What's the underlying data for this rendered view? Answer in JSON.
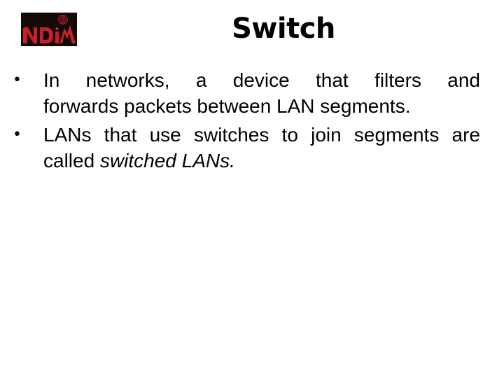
{
  "logo": {
    "text": "NDIM",
    "icon": "globe-icon",
    "colors": {
      "background": "#140a0a",
      "letters": "#c8202a"
    }
  },
  "title": "Switch",
  "bullets": [
    {
      "marker": "•",
      "line1": "In networks, a device that filters and",
      "line2": "forwards packets between LAN segments."
    },
    {
      "marker": "•",
      "text_plain": "LANs that use switches to join segments are called ",
      "text_italic": "switched LANs."
    }
  ]
}
